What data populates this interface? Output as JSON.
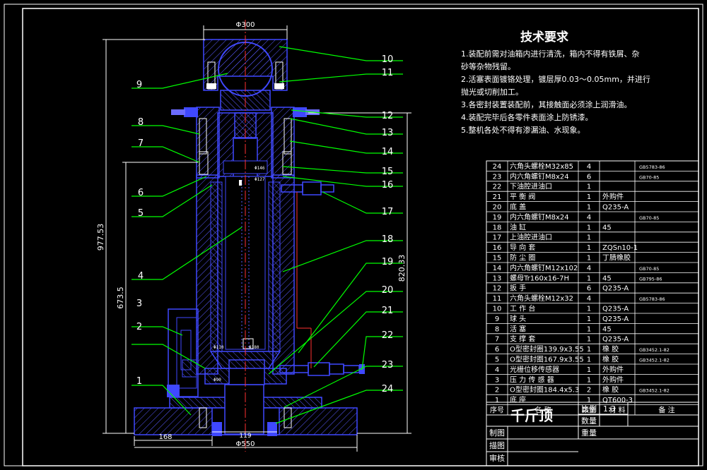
{
  "drawing": {
    "title": "千斤顶",
    "scale_label": "比例",
    "scale_value": "1:3",
    "qty_label": "数量",
    "weight_label": "重量",
    "draw_label": "制图",
    "trace_label": "描图",
    "review_label": "审核"
  },
  "tech_requirements": {
    "heading": "技术要求",
    "lines": [
      "1.装配前需对油箱内进行清洗，箱内不得有铁屑、杂",
      "砂等杂物残留。",
      "2.活塞表面镀铬处理，镀层厚0.03～0.05mm，并进行",
      "抛光或切削加工。",
      "3.各密封装置装配前，其接触面必须涂上润滑油。",
      "4.装配完毕后各零件表面涂上防锈漆。",
      "5.整机各处不得有渗漏油、水现象。"
    ]
  },
  "dimensions": {
    "top_width": "Φ300",
    "overall_height": "977.53",
    "inner_height": "673.5",
    "right_height": "820.33",
    "base_offset": "168",
    "bottom_width": "Φ550",
    "bottom_inner": "119",
    "small_1": "Φ146",
    "small_2": "Φ127",
    "small_3": "Φ110",
    "small_4": "Φ90",
    "small_5": "Φ180"
  },
  "callouts": {
    "left": [
      "9",
      "8",
      "7",
      "6",
      "5",
      "4",
      "3",
      "2",
      "1"
    ],
    "right": [
      "10",
      "11",
      "12",
      "13",
      "14",
      "15",
      "16",
      "17",
      "18",
      "19",
      "20",
      "21",
      "22",
      "23",
      "24"
    ]
  },
  "bom": {
    "header": {
      "no": "序号",
      "name": "名   称",
      "qty": "数量",
      "material": "材   料",
      "note": "备  注"
    },
    "rows": [
      {
        "no": "24",
        "name": "六角头螺栓M32x85",
        "qty": "4",
        "material": "",
        "note": "GB5783-86"
      },
      {
        "no": "23",
        "name": "内六角螺钉M8x24",
        "qty": "6",
        "material": "",
        "note": "GB70-85"
      },
      {
        "no": "22",
        "name": "下油腔进油口",
        "qty": "1",
        "material": "",
        "note": ""
      },
      {
        "no": "21",
        "name": "平  衡  阀",
        "qty": "1",
        "material": "外购件",
        "note": ""
      },
      {
        "no": "20",
        "name": "底    盖",
        "qty": "1",
        "material": "Q235-A",
        "note": ""
      },
      {
        "no": "19",
        "name": "内六角螺钉M8x24",
        "qty": "4",
        "material": "",
        "note": "GB70-85"
      },
      {
        "no": "18",
        "name": "油    缸",
        "qty": "1",
        "material": "45",
        "note": ""
      },
      {
        "no": "17",
        "name": "上油腔进油口",
        "qty": "1",
        "material": "",
        "note": ""
      },
      {
        "no": "16",
        "name": "导  向  套",
        "qty": "1",
        "material": "ZQSn10-1",
        "note": ""
      },
      {
        "no": "15",
        "name": "防  尘  圈",
        "qty": "1",
        "material": "丁腈橡胶",
        "note": ""
      },
      {
        "no": "14",
        "name": "内六角螺钉M12x102",
        "qty": "4",
        "material": "",
        "note": "GB70-85"
      },
      {
        "no": "13",
        "name": "螺母Tr160x16-7H",
        "qty": "1",
        "material": "45",
        "note": "GB795-86"
      },
      {
        "no": "12",
        "name": "扳    手",
        "qty": "6",
        "material": "Q235-A",
        "note": ""
      },
      {
        "no": "11",
        "name": "六角头螺栓M12x32",
        "qty": "4",
        "material": "",
        "note": "GB5783-86"
      },
      {
        "no": "10",
        "name": "工  作  台",
        "qty": "1",
        "material": "Q235-A",
        "note": ""
      },
      {
        "no": "9",
        "name": "球    头",
        "qty": "1",
        "material": "Q235-A",
        "note": ""
      },
      {
        "no": "8",
        "name": "活    塞",
        "qty": "1",
        "material": "45",
        "note": ""
      },
      {
        "no": "7",
        "name": "支  撑  套",
        "qty": "1",
        "material": "Q235-A",
        "note": ""
      },
      {
        "no": "6",
        "name": "O型密封圈139.9x3.55",
        "qty": "1",
        "material": "橡  胶",
        "note": "GB3452.1-82"
      },
      {
        "no": "5",
        "name": "O型密封圈167.9x3.55",
        "qty": "1",
        "material": "橡  胶",
        "note": "GB3452.1-82"
      },
      {
        "no": "4",
        "name": "光栅位移传感器",
        "qty": "1",
        "material": "外购件",
        "note": ""
      },
      {
        "no": "3",
        "name": "压  力  传  感  器",
        "qty": "1",
        "material": "外购件",
        "note": ""
      },
      {
        "no": "2",
        "name": "O型密封圈184.4x5.3",
        "qty": "2",
        "material": "橡  胶",
        "note": "GB3452.1-82"
      },
      {
        "no": "1",
        "name": "底    座",
        "qty": "1",
        "material": "QT600-3",
        "note": ""
      }
    ]
  },
  "colors": {
    "background": "#000000",
    "frame": "#ffffff",
    "part_outline": "#3f48ff",
    "hatch": "#5a5aff",
    "leader": "#00ff00",
    "dimension": "#ff3030",
    "center": "#ff3030",
    "text": "#ffffff"
  }
}
